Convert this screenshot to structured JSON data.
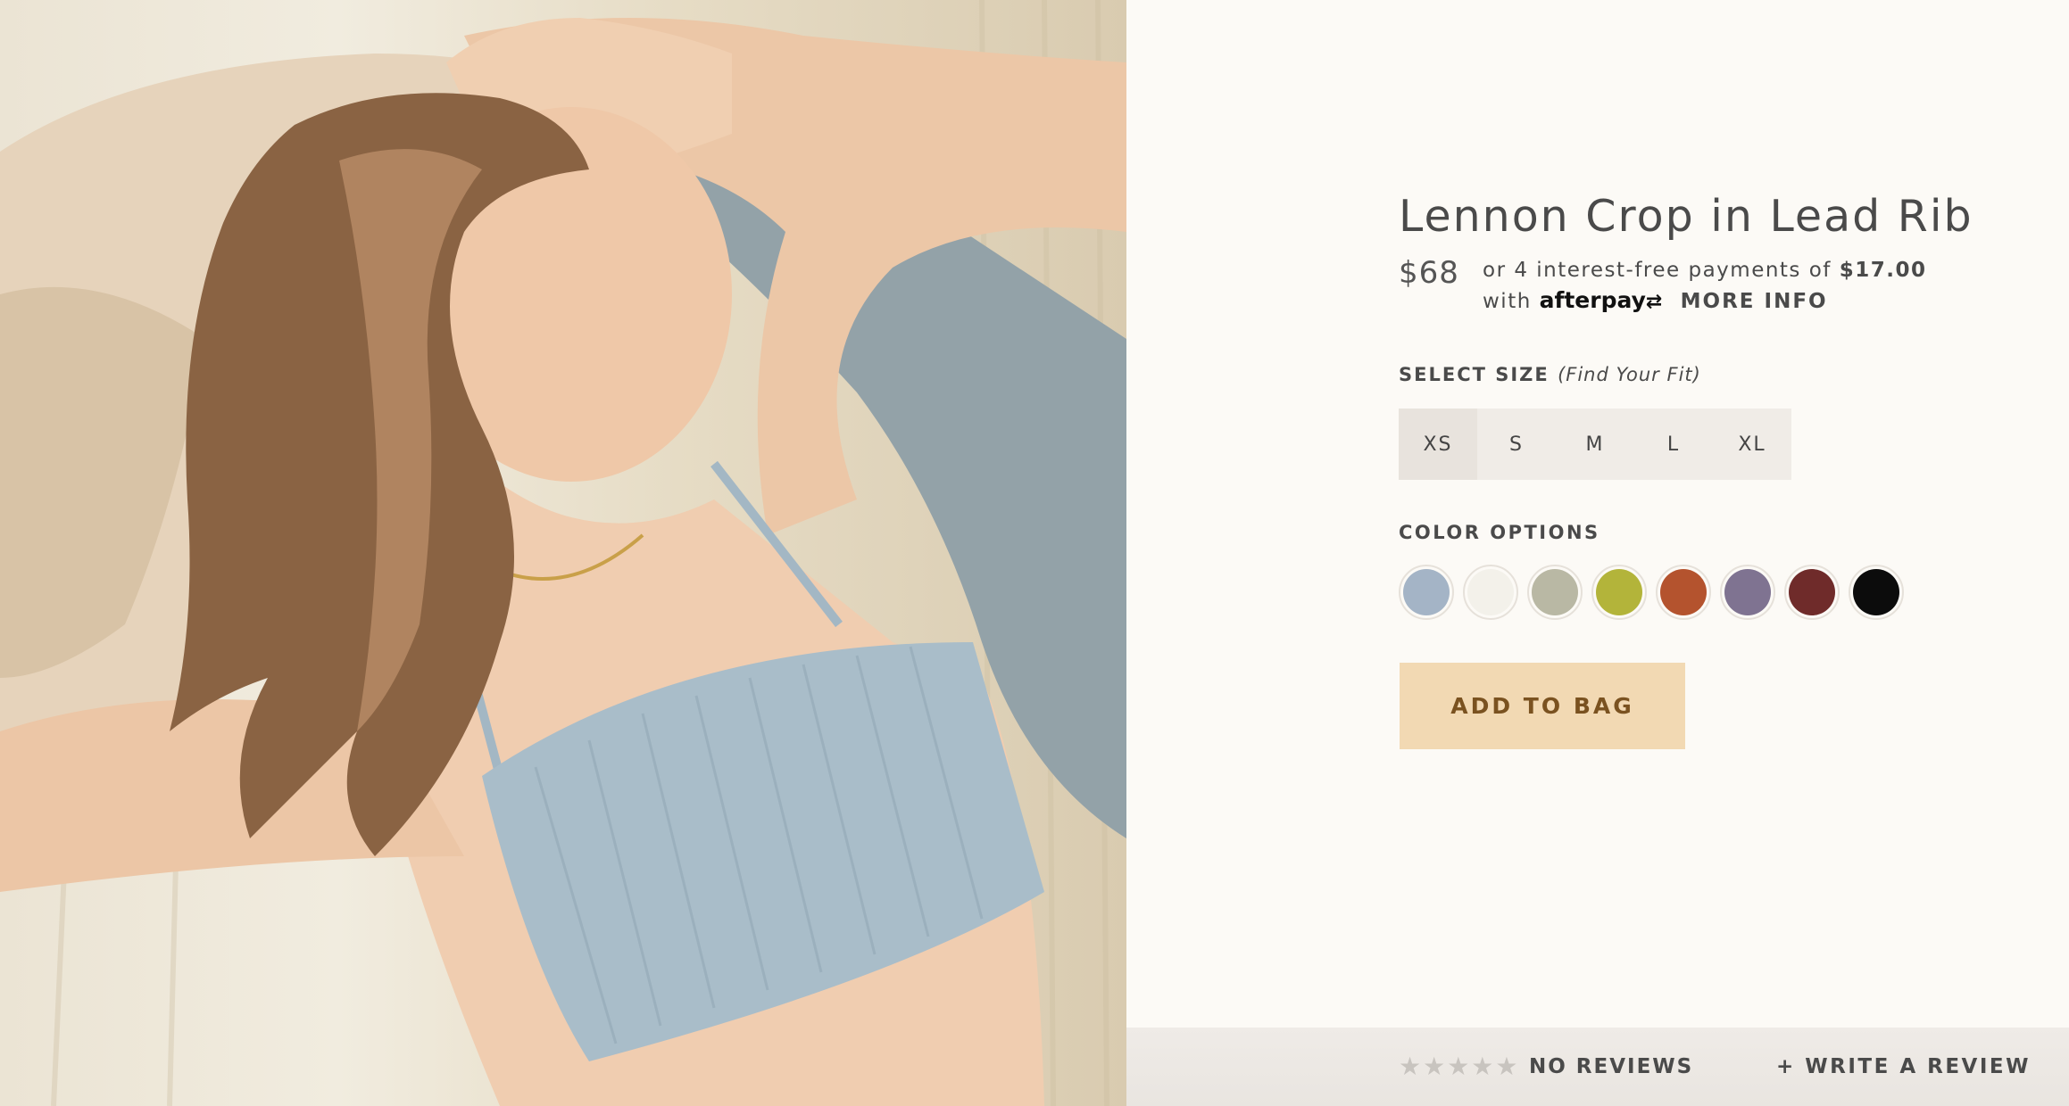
{
  "product": {
    "title": "Lennon Crop in Lead Rib",
    "price": "$68",
    "afterpay": {
      "prefix": "or 4 interest-free payments of",
      "amount": "$17.00",
      "with": "with",
      "brand": "afterpay",
      "more_info": "MORE INFO",
      "icon": "afterpay-arrows-icon"
    }
  },
  "size": {
    "label": "SELECT SIZE",
    "fit_link": "(Find Your Fit)",
    "options": [
      "XS",
      "S",
      "M",
      "L",
      "XL"
    ],
    "selected": "XS"
  },
  "color": {
    "label": "COLOR OPTIONS",
    "swatches": [
      "#a4b4c6",
      "#f3f1ea",
      "#b9b8a4",
      "#b3b43a",
      "#b4532e",
      "#7f7391",
      "#6f2b2a",
      "#0c0c0c"
    ]
  },
  "cart": {
    "add_label": "ADD TO BAG"
  },
  "reviews": {
    "stars": "★★★★★",
    "rating_filled": 0,
    "count_label": "NO REVIEWS",
    "write_label": "+ WRITE A REVIEW"
  },
  "colors": {
    "accent_button_bg": "#f2d9b3",
    "accent_button_text": "#7a5220",
    "page_bg": "#fcfaf6"
  }
}
